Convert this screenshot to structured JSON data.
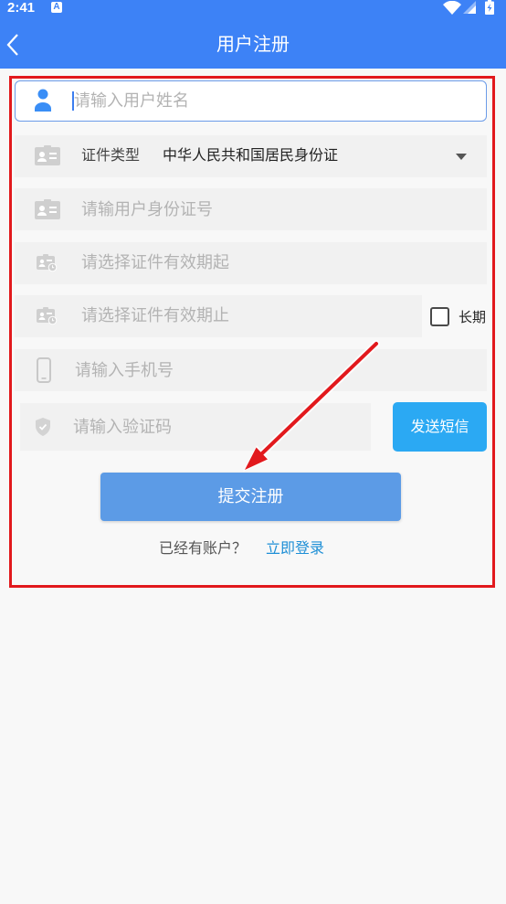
{
  "status_bar": {
    "time": "2:41",
    "notification_glyph": "A",
    "icons": [
      "notification-a-icon",
      "wifi-icon",
      "signal-icon",
      "battery-charging-icon"
    ]
  },
  "header": {
    "title": "用户注册",
    "back_icon": "chevron-left-icon"
  },
  "colors": {
    "primary": "#3d82f6",
    "send_button": "#2ba9f3",
    "submit_button": "#5c9be6",
    "link": "#1e8fd6",
    "annotation_red": "#e2191d",
    "background": "#f8f8f8"
  },
  "form": {
    "name_field": {
      "placeholder": "请输入用户姓名",
      "value": "",
      "icon": "person-icon",
      "focused": true
    },
    "id_type": {
      "label": "证件类型",
      "value": "中华人民共和国居民身份证",
      "icon": "id-card-icon",
      "dropdown_icon": "caret-down-icon"
    },
    "id_number": {
      "placeholder": "请输用户身份证号",
      "value": "",
      "icon": "id-card-icon"
    },
    "valid_from": {
      "placeholder": "请选择证件有效期起",
      "icon": "id-card-clock-icon"
    },
    "valid_to": {
      "placeholder": "请选择证件有效期止",
      "icon": "id-card-clock-icon"
    },
    "long_term": {
      "label": "长期",
      "checked": false
    },
    "phone": {
      "placeholder": "请输入手机号",
      "value": "",
      "icon": "phone-icon"
    },
    "sms_code": {
      "placeholder": "请输入验证码",
      "value": "",
      "icon": "shield-check-icon"
    },
    "send_sms_label": "发送短信",
    "submit_label": "提交注册"
  },
  "login_prompt": {
    "text": "已经有账户？",
    "link": "立即登录"
  },
  "annotation": {
    "shapes": [
      "highlight-box",
      "arrow-to-submit-button"
    ]
  }
}
